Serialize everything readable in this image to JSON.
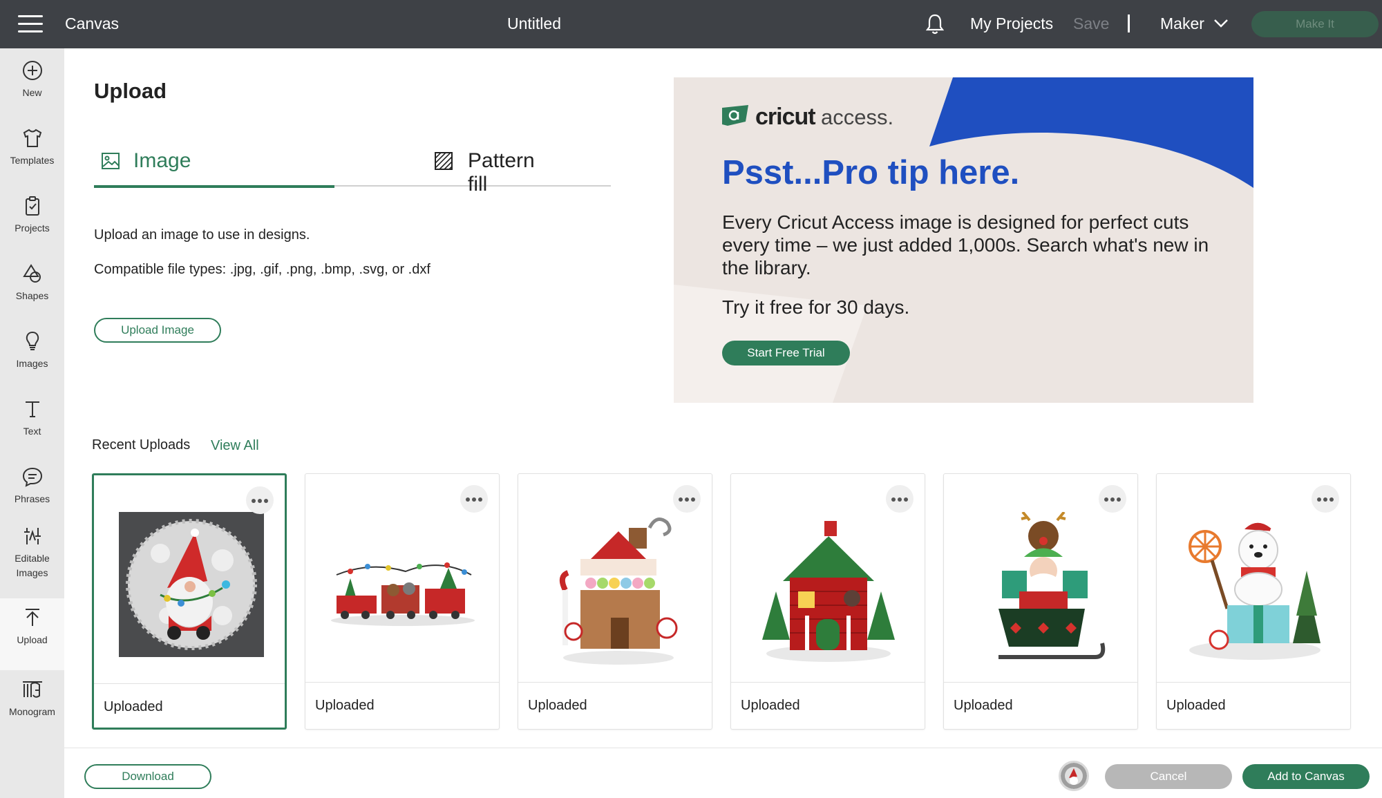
{
  "topbar": {
    "app_title": "Canvas",
    "doc_title": "Untitled",
    "my_projects": "My Projects",
    "save": "Save",
    "machine": "Maker",
    "make_it": "Make It"
  },
  "rail": {
    "items": [
      {
        "label": "New",
        "icon": "plus-circle-icon"
      },
      {
        "label": "Templates",
        "icon": "shirt-icon"
      },
      {
        "label": "Projects",
        "icon": "clipboard-icon"
      },
      {
        "label": "Shapes",
        "icon": "shapes-icon"
      },
      {
        "label": "Images",
        "icon": "lightbulb-icon"
      },
      {
        "label": "Text",
        "icon": "text-icon"
      },
      {
        "label": "Phrases",
        "icon": "speech-bubble-icon"
      },
      {
        "label": "Editable Images",
        "icon": "editable-images-icon"
      },
      {
        "label": "Upload",
        "icon": "upload-arrow-icon",
        "active": true
      },
      {
        "label": "Monogram",
        "icon": "monogram-icon"
      }
    ]
  },
  "upload": {
    "title": "Upload",
    "tabs": [
      {
        "label": "Image",
        "icon": "image-icon",
        "selected": true
      },
      {
        "label": "Pattern fill",
        "icon": "pattern-fill-icon",
        "selected": false
      }
    ],
    "description": "Upload an image to use in designs.",
    "file_types": "Compatible file types: .jpg, .gif, .png, .bmp, .svg, or .dxf",
    "upload_button": "Upload Image"
  },
  "promo": {
    "logo_bold": "cricut",
    "logo_light": "access.",
    "headline": "Psst...Pro tip here.",
    "body": "Every Cricut Access image is designed for perfect cuts every time – we just added 1,000s. Search what's new in the library.",
    "trial_text": "Try it free for 30 days.",
    "button": "Start Free Trial",
    "colors": {
      "background": "#ece5e1",
      "accent_blue": "#1f4fc0",
      "button_green": "#2f7d5a"
    }
  },
  "recent": {
    "title": "Recent Uploads",
    "view_all": "View All",
    "cards": [
      {
        "caption": "Uploaded",
        "subject": "gnome in snow globe",
        "selected": true
      },
      {
        "caption": "Uploaded",
        "subject": "christmas train"
      },
      {
        "caption": "Uploaded",
        "subject": "gingerbread house"
      },
      {
        "caption": "Uploaded",
        "subject": "santa's red cottage"
      },
      {
        "caption": "Uploaded",
        "subject": "santa in sleigh with reindeer"
      },
      {
        "caption": "Uploaded",
        "subject": "polar bear with gift"
      }
    ]
  },
  "footer": {
    "download": "Download",
    "cancel": "Cancel",
    "add_to_canvas": "Add to Canvas"
  }
}
